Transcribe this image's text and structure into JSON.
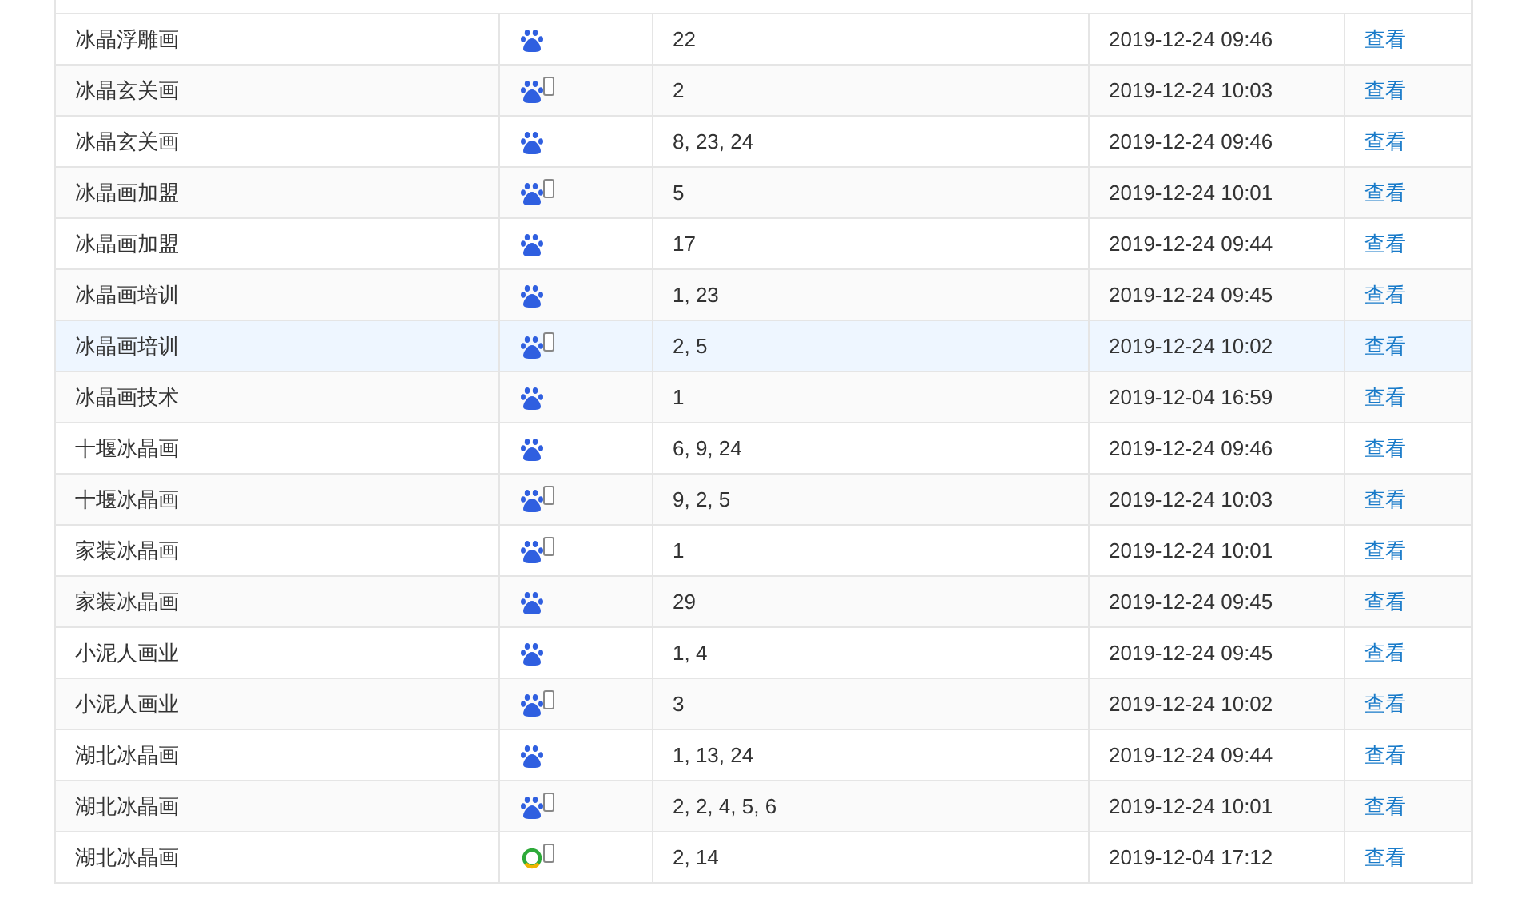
{
  "rows": [
    {
      "keyword": "冰晶浮雕画",
      "kind": "baidu",
      "mobile": false,
      "ranks": "22",
      "time": "2019-12-24 09:46",
      "action": "查看",
      "highlighted": false
    },
    {
      "keyword": "冰晶玄关画",
      "kind": "baidu",
      "mobile": true,
      "ranks": "2",
      "time": "2019-12-24 10:03",
      "action": "查看",
      "highlighted": false
    },
    {
      "keyword": "冰晶玄关画",
      "kind": "baidu",
      "mobile": false,
      "ranks": "8, 23, 24",
      "time": "2019-12-24 09:46",
      "action": "查看",
      "highlighted": false
    },
    {
      "keyword": "冰晶画加盟",
      "kind": "baidu",
      "mobile": true,
      "ranks": "5",
      "time": "2019-12-24 10:01",
      "action": "查看",
      "highlighted": false
    },
    {
      "keyword": "冰晶画加盟",
      "kind": "baidu",
      "mobile": false,
      "ranks": "17",
      "time": "2019-12-24 09:44",
      "action": "查看",
      "highlighted": false
    },
    {
      "keyword": "冰晶画培训",
      "kind": "baidu",
      "mobile": false,
      "ranks": "1, 23",
      "time": "2019-12-24 09:45",
      "action": "查看",
      "highlighted": false
    },
    {
      "keyword": "冰晶画培训",
      "kind": "baidu",
      "mobile": true,
      "ranks": "2, 5",
      "time": "2019-12-24 10:02",
      "action": "查看",
      "highlighted": true
    },
    {
      "keyword": "冰晶画技术",
      "kind": "baidu",
      "mobile": false,
      "ranks": "1",
      "time": "2019-12-04 16:59",
      "action": "查看",
      "highlighted": false
    },
    {
      "keyword": "十堰冰晶画",
      "kind": "baidu",
      "mobile": false,
      "ranks": "6, 9, 24",
      "time": "2019-12-24 09:46",
      "action": "查看",
      "highlighted": false
    },
    {
      "keyword": "十堰冰晶画",
      "kind": "baidu",
      "mobile": true,
      "ranks": "9, 2, 5",
      "time": "2019-12-24 10:03",
      "action": "查看",
      "highlighted": false
    },
    {
      "keyword": "家装冰晶画",
      "kind": "baidu",
      "mobile": true,
      "ranks": "1",
      "time": "2019-12-24 10:01",
      "action": "查看",
      "highlighted": false
    },
    {
      "keyword": "家装冰晶画",
      "kind": "baidu",
      "mobile": false,
      "ranks": "29",
      "time": "2019-12-24 09:45",
      "action": "查看",
      "highlighted": false
    },
    {
      "keyword": "小泥人画业",
      "kind": "baidu",
      "mobile": false,
      "ranks": "1, 4",
      "time": "2019-12-24 09:45",
      "action": "查看",
      "highlighted": false
    },
    {
      "keyword": "小泥人画业",
      "kind": "baidu",
      "mobile": true,
      "ranks": "3",
      "time": "2019-12-24 10:02",
      "action": "查看",
      "highlighted": false
    },
    {
      "keyword": "湖北冰晶画",
      "kind": "baidu",
      "mobile": false,
      "ranks": "1, 13, 24",
      "time": "2019-12-24 09:44",
      "action": "查看",
      "highlighted": false
    },
    {
      "keyword": "湖北冰晶画",
      "kind": "baidu",
      "mobile": true,
      "ranks": "2, 2, 4, 5, 6",
      "time": "2019-12-24 10:01",
      "action": "查看",
      "highlighted": false
    },
    {
      "keyword": "湖北冰晶画",
      "kind": "ring",
      "mobile": true,
      "ranks": "2, 14",
      "time": "2019-12-04 17:12",
      "action": "查看",
      "highlighted": false
    }
  ]
}
